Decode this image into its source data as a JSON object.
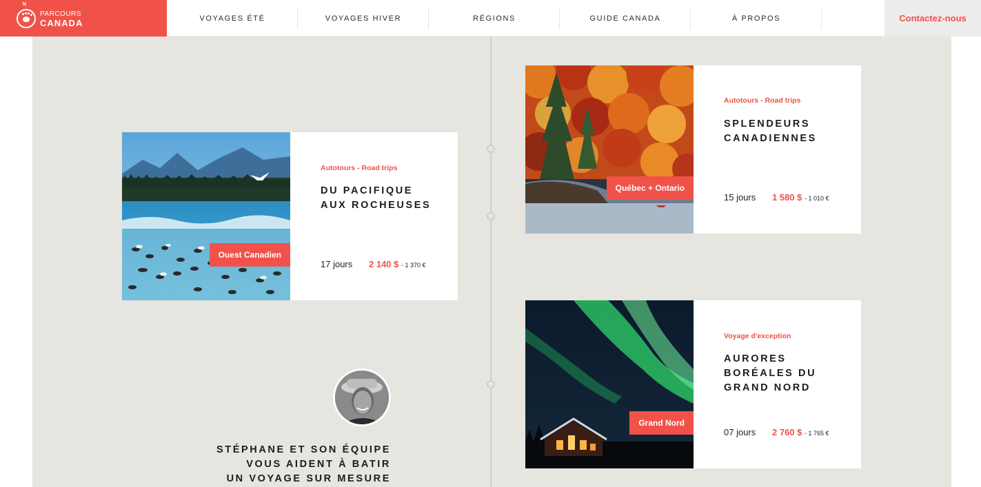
{
  "brand": {
    "small": "PARCOURS",
    "large": "CANADA",
    "compass_letter": "N",
    "color": "#f0524a"
  },
  "nav": {
    "items": [
      "VOYAGES ÉTÉ",
      "VOYAGES HIVER",
      "RÉGIONS",
      "GUIDE CANADA",
      "À PROPOS"
    ],
    "contact": "Contactez-nous"
  },
  "trips": [
    {
      "category": "Autotours - Road trips",
      "title_lines": [
        "DU PACIFIQUE",
        "AUX ROCHEUSES"
      ],
      "region": "Ouest Canadien",
      "duration": "17 jours",
      "price": "2 140 $",
      "price_eur": "- 1 370 €",
      "image": "coastal-mountains-seagulls"
    },
    {
      "category": "Autotours - Road trips",
      "title_lines": [
        "SPLENDEURS",
        "CANADIENNES"
      ],
      "region": "Québec + Ontario",
      "duration": "15 jours",
      "price": "1 580 $",
      "price_eur": "- 1 010 €",
      "image": "autumn-forest-lake"
    },
    {
      "category": "Voyage d'exception",
      "title_lines": [
        "AURORES",
        "BORÉALES DU",
        "GRAND NORD"
      ],
      "region": "Grand Nord",
      "duration": "07 jours",
      "price": "2 760 $",
      "price_eur": "- 1 765 €",
      "image": "aurora-borealis-cabin"
    }
  ],
  "team": {
    "lines": [
      "STÉPHANE ET SON ÉQUIPE",
      "VOUS AIDENT À BATIR",
      "UN VOYAGE SUR MESURE"
    ],
    "avatar": "advisor-portrait"
  }
}
